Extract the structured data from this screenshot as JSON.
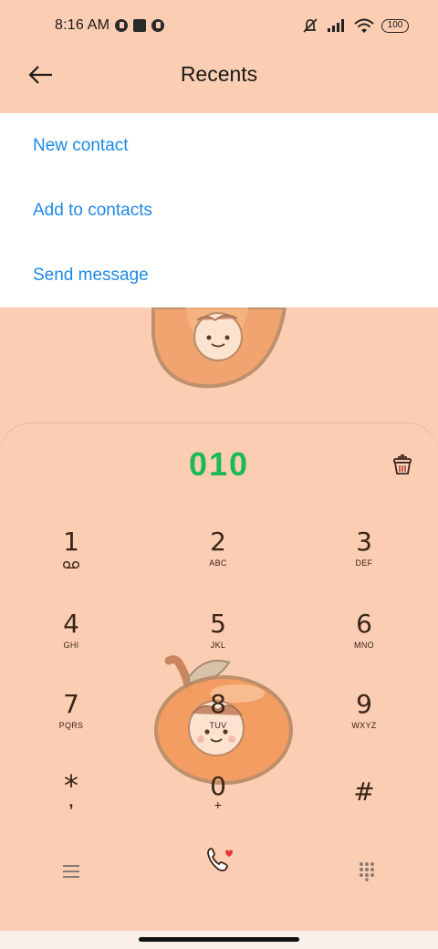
{
  "status_bar": {
    "time": "8:16 AM",
    "battery": "100",
    "icons": [
      "app-notification-icon",
      "stop-icon",
      "app-notification-icon",
      "mute-icon",
      "signal-icon",
      "wifi-icon",
      "battery-icon"
    ]
  },
  "header": {
    "title": "Recents",
    "back_icon": "back-arrow-icon"
  },
  "menu": {
    "items": [
      {
        "label": "New contact"
      },
      {
        "label": "Add to contacts"
      },
      {
        "label": "Send message"
      }
    ]
  },
  "dialer": {
    "number": "010",
    "keys": [
      {
        "digit": "1",
        "letters": ""
      },
      {
        "digit": "2",
        "letters": "ABC"
      },
      {
        "digit": "3",
        "letters": "DEF"
      },
      {
        "digit": "4",
        "letters": "GHI"
      },
      {
        "digit": "5",
        "letters": "JKL"
      },
      {
        "digit": "6",
        "letters": "MNO"
      },
      {
        "digit": "7",
        "letters": "PQRS"
      },
      {
        "digit": "8",
        "letters": "TUV"
      },
      {
        "digit": "9",
        "letters": "WXYZ"
      },
      {
        "digit": "*",
        "letters": ","
      },
      {
        "digit": "0",
        "letters": "+"
      },
      {
        "digit": "#",
        "letters": ""
      }
    ],
    "bottom_icons": [
      "menu-icon",
      "call-icon",
      "dialpad-icon"
    ]
  },
  "colors": {
    "background": "#FBCDB2",
    "accent_link": "#1E88E5",
    "number_green": "#1DB954"
  }
}
